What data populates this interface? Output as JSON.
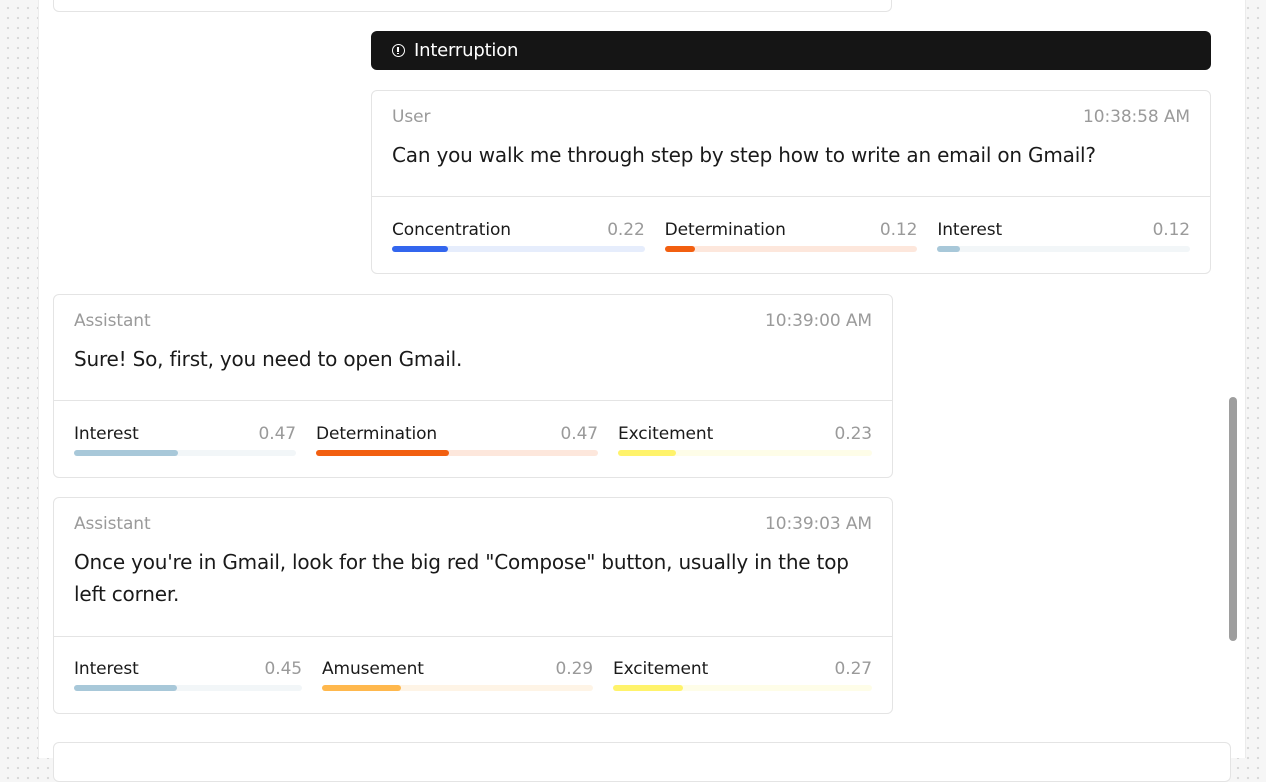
{
  "interruption": {
    "label": "Interruption",
    "icon": "alert-circle-icon"
  },
  "messages": [
    {
      "role": "User",
      "time": "10:38:58 AM",
      "text": "Can you walk me through step by step how to write an email on Gmail?",
      "emotions": [
        {
          "name": "Concentration",
          "value": "0.22",
          "level": 0.22,
          "color": "#3366ee",
          "track": "#e6edfc"
        },
        {
          "name": "Determination",
          "value": "0.12",
          "level": 0.12,
          "color": "#f25f10",
          "track": "#fde7dc"
        },
        {
          "name": "Interest",
          "value": "0.12",
          "level": 0.09,
          "color": "#a8c8d9",
          "track": "#f2f6f8"
        }
      ]
    },
    {
      "role": "Assistant",
      "time": "10:39:00 AM",
      "text": "Sure! So, first, you need to open Gmail.",
      "emotions": [
        {
          "name": "Interest",
          "value": "0.47",
          "level": 0.47,
          "color": "#a8c8d9",
          "track": "#f2f6f8"
        },
        {
          "name": "Determination",
          "value": "0.47",
          "level": 0.47,
          "color": "#f25f10",
          "track": "#fde7dc"
        },
        {
          "name": "Excitement",
          "value": "0.23",
          "level": 0.23,
          "color": "#fff36b",
          "track": "#fefde8"
        }
      ]
    },
    {
      "role": "Assistant",
      "time": "10:39:03 AM",
      "text": "Once you're in Gmail, look for the big red \"Compose\" button, usually in the top left corner.",
      "emotions": [
        {
          "name": "Interest",
          "value": "0.45",
          "level": 0.45,
          "color": "#a8c8d9",
          "track": "#f2f6f8"
        },
        {
          "name": "Amusement",
          "value": "0.29",
          "level": 0.29,
          "color": "#ffb84d",
          "track": "#fef4e6"
        },
        {
          "name": "Excitement",
          "value": "0.27",
          "level": 0.27,
          "color": "#fff36b",
          "track": "#fefde8"
        }
      ]
    }
  ]
}
